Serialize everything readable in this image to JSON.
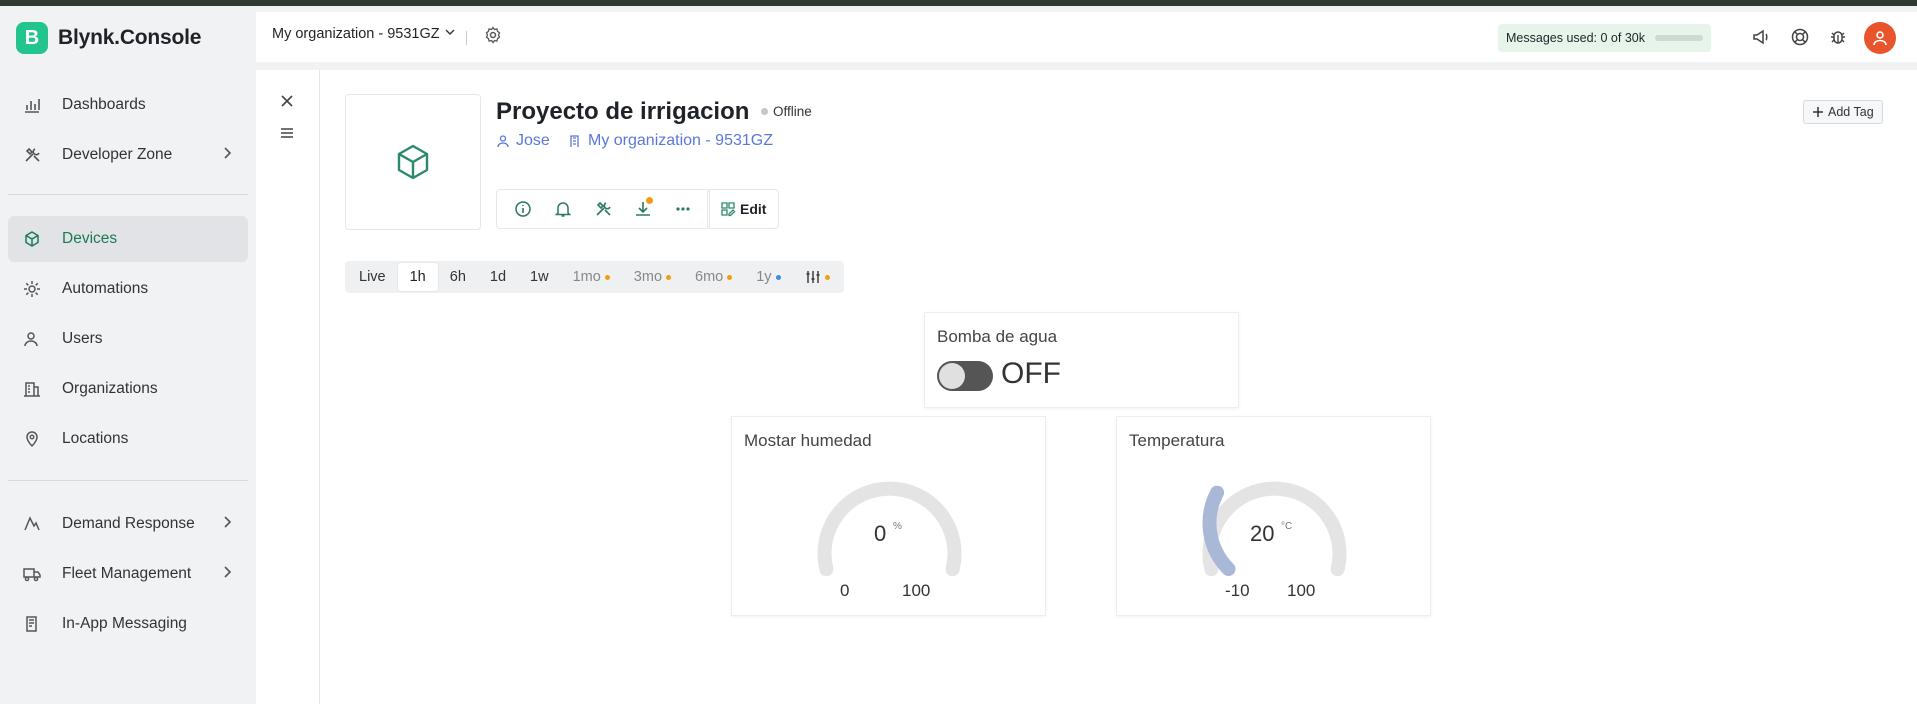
{
  "app": {
    "logo_letter": "B",
    "logo_text": "Blynk.Console"
  },
  "sidebar": {
    "items": [
      {
        "label": "Dashboards",
        "icon": "bar-chart-icon"
      },
      {
        "label": "Developer Zone",
        "icon": "tools-icon"
      },
      {
        "label": "Devices",
        "icon": "cube-icon",
        "active": true
      },
      {
        "label": "Automations",
        "icon": "automation-icon"
      },
      {
        "label": "Users",
        "icon": "users-icon"
      },
      {
        "label": "Organizations",
        "icon": "building-icon"
      },
      {
        "label": "Locations",
        "icon": "location-pin-icon"
      },
      {
        "label": "Demand Response",
        "icon": "signal-icon"
      },
      {
        "label": "Fleet Management",
        "icon": "truck-icon"
      },
      {
        "label": "In-App Messaging",
        "icon": "message-icon"
      }
    ]
  },
  "header": {
    "org_name": "My organization - 9531GZ",
    "messages_label": "Messages used: 0 of 30k",
    "messages_used_fraction": 0
  },
  "device": {
    "title": "Proyecto de irrigacion",
    "status": "Offline",
    "owner": "Jose",
    "organization": "My organization - 9531GZ",
    "edit_label": "Edit",
    "add_tag_label": "Add Tag"
  },
  "time_ranges": [
    {
      "label": "Live"
    },
    {
      "label": "1h",
      "selected": true
    },
    {
      "label": "6h"
    },
    {
      "label": "1d"
    },
    {
      "label": "1w"
    },
    {
      "label": "1mo",
      "dot": "#f39c12",
      "muted": true
    },
    {
      "label": "3mo",
      "dot": "#f39c12",
      "muted": true
    },
    {
      "label": "6mo",
      "dot": "#f39c12",
      "muted": true
    },
    {
      "label": "1y",
      "dot": "#3a8de0",
      "muted": true
    }
  ],
  "widgets": {
    "switch": {
      "title": "Bomba de agua",
      "state": "OFF"
    },
    "humidity": {
      "title": "Mostar humedad",
      "value": "0",
      "unit": "%",
      "min": "0",
      "max": "100",
      "fill_fraction": 0
    },
    "temperature": {
      "title": "Temperatura",
      "value": "20",
      "unit": "°C",
      "min": "-10",
      "max": "100",
      "fill_fraction": 0.27
    }
  },
  "colors": {
    "brand": "#23c48e",
    "accent": "#1b7a55",
    "link": "#5a78d8",
    "gauge_fill": "#a9b8d6",
    "gauge_track": "#e4e4e4"
  }
}
